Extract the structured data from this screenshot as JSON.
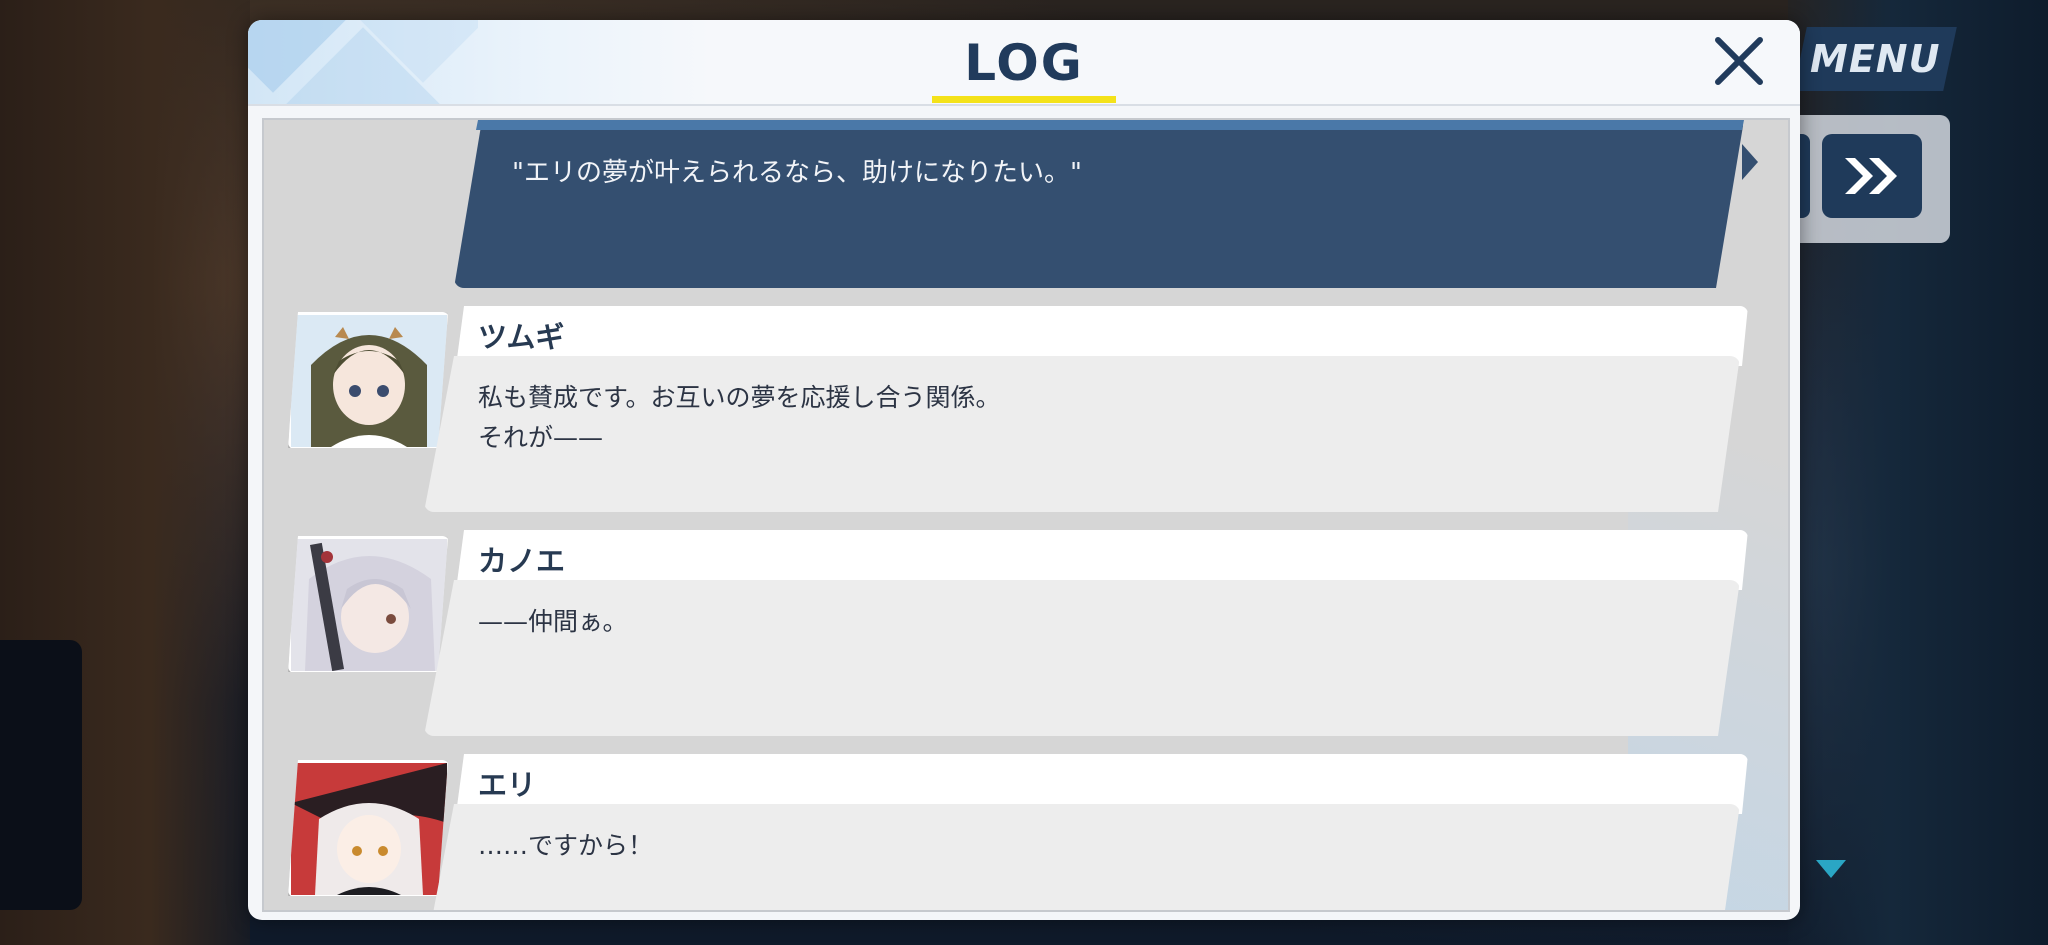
{
  "header": {
    "title": "LOG"
  },
  "hud": {
    "menu_label": "MENU",
    "skip_label": "»"
  },
  "choice": {
    "text": "\"エリの夢が叶えられるなら、助けになりたい。\""
  },
  "entries": [
    {
      "name": "ツムギ",
      "lines": [
        "私も賛成です。お互いの夢を応援し合う関係。",
        "それが——"
      ]
    },
    {
      "name": "カノエ",
      "lines": [
        "——仲間ぁ。"
      ]
    },
    {
      "name": "エリ",
      "lines": [
        "……ですから！"
      ]
    }
  ],
  "colors": {
    "title": "#213b5c",
    "title_underline": "#f4e21a",
    "choice_bg": "#344f70",
    "menu_bg": "#1f3a5a"
  },
  "icons": {
    "close": "close-icon",
    "skip": "fast-forward-icon",
    "scroll": "scroll-down-arrow-icon"
  }
}
